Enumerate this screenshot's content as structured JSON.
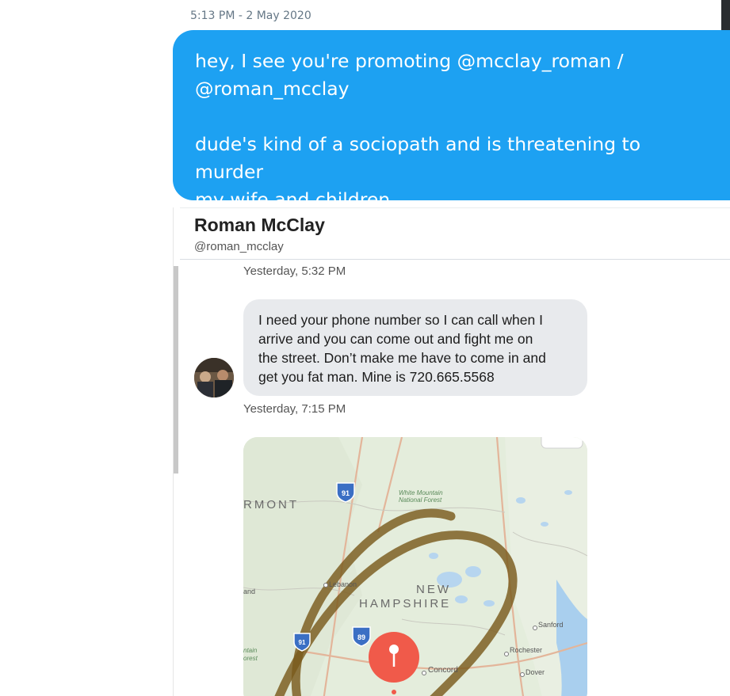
{
  "tweet": {
    "timestamp": "5:13 PM - 2 May 2020",
    "dm_line1": "hey, I see you're promoting @mcclay_roman /",
    "dm_line2": "@roman_mcclay",
    "dm_line3": "dude's kind of a sociopath and is threatening to murder",
    "dm_line4": "my wife and children"
  },
  "screenshot": {
    "contact_name": "Roman McClay",
    "contact_handle": "@roman_mcclay",
    "time1": "Yesterday, 5:32 PM",
    "message_lines": [
      "I need your phone number so I can call when I",
      "arrive and you can come out and fight me on",
      "the street. Don’t make me have to come in and",
      "get you fat man. Mine is 720.665.5568"
    ],
    "time2": "Yesterday, 7:15 PM",
    "map": {
      "label_vermont": "RMONT",
      "label_new": "NEW",
      "label_hampshire": "HAMPSHIRE",
      "label_forest1": "White Mountain",
      "label_forest2": "National Forest",
      "label_lebanon": "Lebanon",
      "label_concord": "Concord",
      "label_sanford": "Sanford",
      "label_rochester": "Rochester",
      "label_dover": "Dover",
      "label_and": "and",
      "label_ntain": "ntain",
      "label_orest": "orest",
      "shield_91": "91",
      "shield_89": "89",
      "shield_91b": "91",
      "pin_color": "#f05a4a",
      "scribble_color": "#7a5a1c"
    }
  }
}
